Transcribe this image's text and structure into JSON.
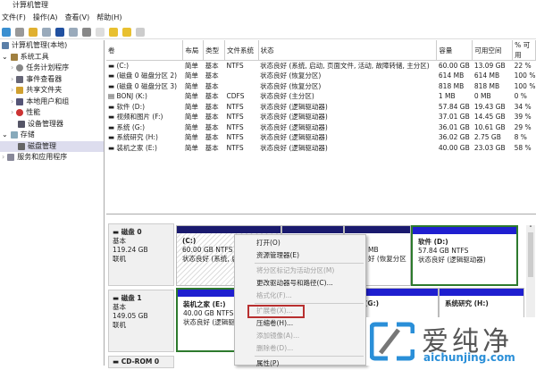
{
  "window": {
    "title": "计算机管理"
  },
  "menu": [
    "文件(F)",
    "操作(A)",
    "查看(V)",
    "帮助(H)"
  ],
  "tree": [
    {
      "label": "计算机管理(本地)",
      "indent": 0
    },
    {
      "label": "系统工具",
      "indent": 1
    },
    {
      "label": "任务计划程序",
      "indent": 2
    },
    {
      "label": "事件查看器",
      "indent": 2
    },
    {
      "label": "共享文件夹",
      "indent": 2
    },
    {
      "label": "本地用户和组",
      "indent": 2
    },
    {
      "label": "性能",
      "indent": 2
    },
    {
      "label": "设备管理器",
      "indent": 2
    },
    {
      "label": "存储",
      "indent": 1
    },
    {
      "label": "磁盘管理",
      "indent": 2
    },
    {
      "label": "服务和应用程序",
      "indent": 1
    }
  ],
  "volumes": {
    "headers": [
      "卷",
      "布局",
      "类型",
      "文件系统",
      "状态",
      "容量",
      "可用空间",
      "% 可用"
    ],
    "rows": [
      [
        "(C:)",
        "简单",
        "基本",
        "NTFS",
        "状态良好 (系统, 启动, 页面文件, 活动, 故障转储, 主分区)",
        "60.00 GB",
        "13.09 GB",
        "22 %"
      ],
      [
        "(磁盘 0 磁盘分区 2)",
        "简单",
        "基本",
        "",
        "状态良好 (恢复分区)",
        "614 MB",
        "614 MB",
        "100 %"
      ],
      [
        "(磁盘 0 磁盘分区 3)",
        "简单",
        "基本",
        "",
        "状态良好 (恢复分区)",
        "818 MB",
        "818 MB",
        "100 %"
      ],
      [
        "BONJ (K:)",
        "简单",
        "基本",
        "CDFS",
        "状态良好 (主分区)",
        "1 MB",
        "0 MB",
        "0 %"
      ],
      [
        "软件 (D:)",
        "简单",
        "基本",
        "NTFS",
        "状态良好 (逻辑驱动器)",
        "57.84 GB",
        "19.43 GB",
        "34 %"
      ],
      [
        "视频和图片 (F:)",
        "简单",
        "基本",
        "NTFS",
        "状态良好 (逻辑驱动器)",
        "37.01 GB",
        "14.45 GB",
        "39 %"
      ],
      [
        "系统 (G:)",
        "简单",
        "基本",
        "NTFS",
        "状态良好 (逻辑驱动器)",
        "36.01 GB",
        "10.61 GB",
        "29 %"
      ],
      [
        "系统研究 (H:)",
        "简单",
        "基本",
        "NTFS",
        "状态良好 (逻辑驱动器)",
        "36.02 GB",
        "2.75 GB",
        "8 %"
      ],
      [
        "装机之家 (E:)",
        "简单",
        "基本",
        "NTFS",
        "状态良好 (逻辑驱动器)",
        "40.00 GB",
        "23.03 GB",
        "58 %"
      ]
    ]
  },
  "disks": {
    "disk0": {
      "name": "磁盘 0",
      "type": "基本",
      "size": "119.24 GB",
      "status": "联机",
      "c": {
        "name": "(C:)",
        "size": "60.00 GB NTFS",
        "status": "状态良好 (系统, 启"
      },
      "p3": {
        "size": "MB",
        "status": "好 (恢复分区"
      },
      "d": {
        "name": "软件 (D:)",
        "size": "57.84 GB NTFS",
        "status": "状态良好 (逻辑驱动器)"
      }
    },
    "disk1": {
      "name": "磁盘 1",
      "type": "基本",
      "size": "149.05 GB",
      "status": "联机",
      "e": {
        "name": "装机之家 (E:)",
        "size": "40.00 GB NTFS",
        "status": "状态良好 (逻辑驱"
      },
      "g": {
        "name": "(G:)"
      },
      "h": {
        "name": "系统研究 (H:)"
      }
    },
    "cdrom": {
      "name": "CD-ROM 0"
    }
  },
  "context_menu": [
    {
      "label": "打开(O)",
      "enabled": true
    },
    {
      "label": "资源管理器(E)",
      "enabled": true
    },
    {
      "label": "将分区标记为活动分区(M)",
      "enabled": false
    },
    {
      "label": "更改驱动器号和路径(C)...",
      "enabled": true
    },
    {
      "label": "格式化(F)...",
      "enabled": false
    },
    {
      "label": "扩展卷(X)...",
      "enabled": false
    },
    {
      "label": "压缩卷(H)...",
      "enabled": true
    },
    {
      "label": "添加镜像(A)...",
      "enabled": false
    },
    {
      "label": "删除卷(D)...",
      "enabled": false
    },
    {
      "label": "属性(P)",
      "enabled": true
    }
  ],
  "watermark": {
    "brand": "爱纯净",
    "url": "aichunjing.com"
  }
}
